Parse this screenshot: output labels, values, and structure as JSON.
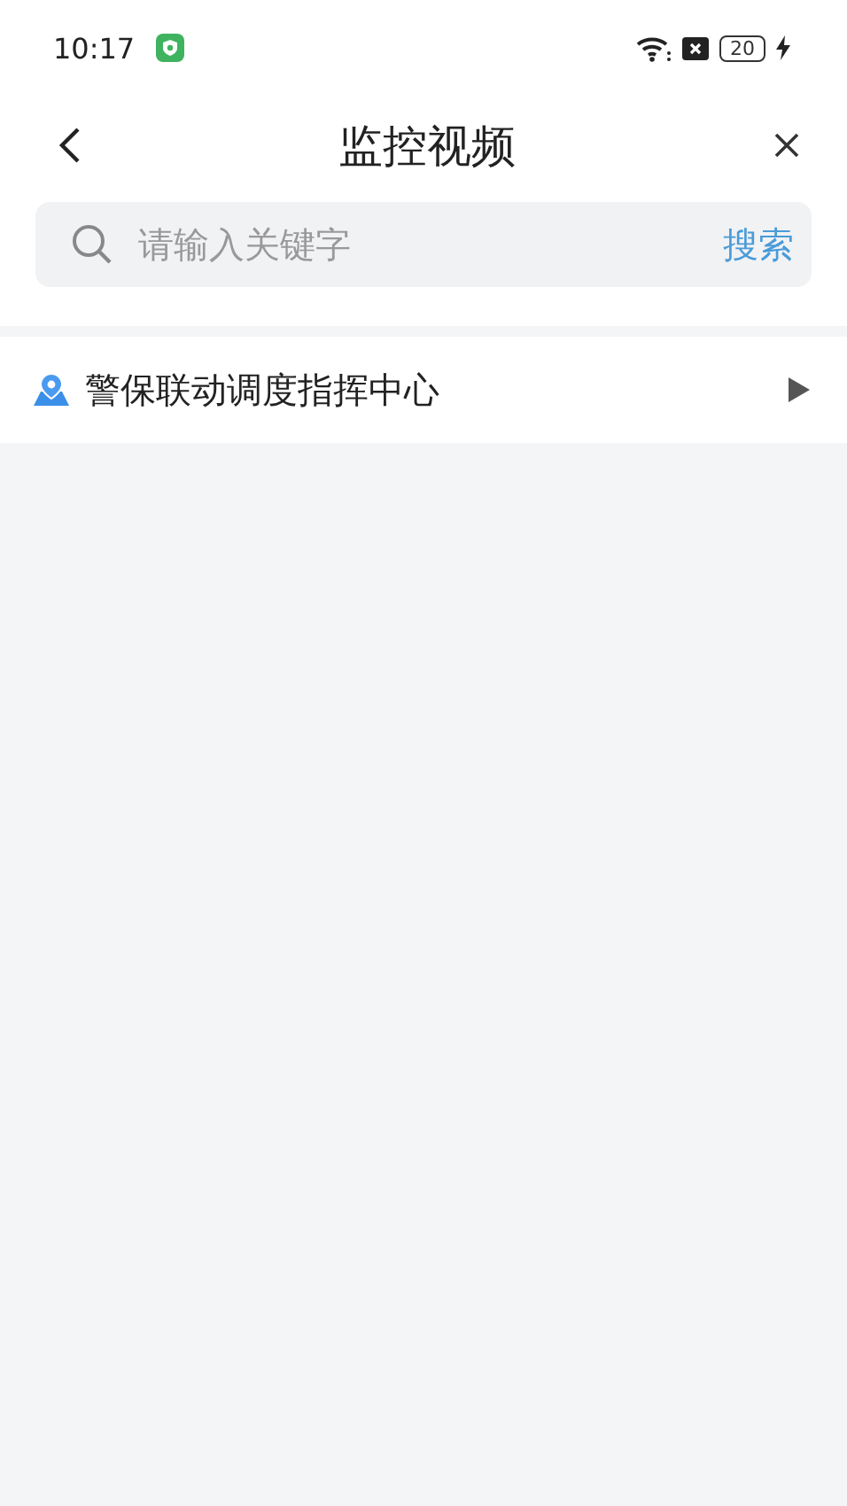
{
  "status_bar": {
    "time": "10:17",
    "battery": "20"
  },
  "header": {
    "title": "监控视频"
  },
  "search": {
    "placeholder": "请输入关键字",
    "button": "搜索"
  },
  "tree": [
    {
      "label": "警保联动调度指挥中心",
      "expanded": false
    }
  ]
}
